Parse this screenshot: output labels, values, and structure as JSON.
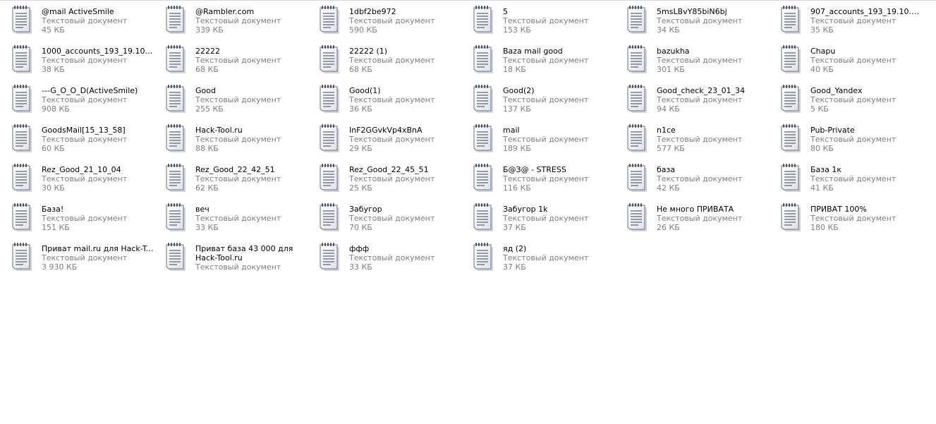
{
  "files": [
    {
      "name": "@mail ActiveSmile",
      "type": "Текстовый документ",
      "size": "45 КБ"
    },
    {
      "name": "@Rambler.com",
      "type": "Текстовый документ",
      "size": "339 КБ"
    },
    {
      "name": "1dbf2be972",
      "type": "Текстовый документ",
      "size": "590 КБ"
    },
    {
      "name": "5",
      "type": "Текстовый документ",
      "size": "153 КБ"
    },
    {
      "name": "5msLBvY85biN6bj",
      "type": "Текстовый документ",
      "size": "34 КБ"
    },
    {
      "name": "907_accounts_193_19.10.201...",
      "type": "Текстовый документ",
      "size": "35 КБ"
    },
    {
      "name": "1000_accounts_193_19.10.20...",
      "type": "Текстовый документ",
      "size": "38 КБ"
    },
    {
      "name": "22222",
      "type": "Текстовый документ",
      "size": "68 КБ"
    },
    {
      "name": "22222 (1)",
      "type": "Текстовый документ",
      "size": "68 КБ"
    },
    {
      "name": "Baza mail good",
      "type": "Текстовый документ",
      "size": "18 КБ"
    },
    {
      "name": "bazukha",
      "type": "Текстовый документ",
      "size": "301 КБ"
    },
    {
      "name": "Chapu",
      "type": "Текстовый документ",
      "size": "40 КБ"
    },
    {
      "name": "---G_O_O_D(ActiveSmile)",
      "type": "Текстовый документ",
      "size": "908 КБ"
    },
    {
      "name": "Good",
      "type": "Текстовый документ",
      "size": "255 КБ"
    },
    {
      "name": "Good(1)",
      "type": "Текстовый документ",
      "size": "36 КБ"
    },
    {
      "name": "Good(2)",
      "type": "Текстовый документ",
      "size": "137 КБ"
    },
    {
      "name": "Good_check_23_01_34",
      "type": "Текстовый документ",
      "size": "94 КБ"
    },
    {
      "name": "Good_Yandex",
      "type": "Текстовый документ",
      "size": "5 КБ"
    },
    {
      "name": "GoodsMail[15_13_58]",
      "type": "Текстовый документ",
      "size": "60 КБ"
    },
    {
      "name": "Hack-Tool.ru",
      "type": "Текстовый документ",
      "size": "88 КБ"
    },
    {
      "name": "InF2GGvkVp4xBnA",
      "type": "Текстовый документ",
      "size": "29 КБ"
    },
    {
      "name": "mail",
      "type": "Текстовый документ",
      "size": "189 КБ"
    },
    {
      "name": "n1ce",
      "type": "Текстовый документ",
      "size": "577 КБ"
    },
    {
      "name": "Pub-Private",
      "type": "Текстовый документ",
      "size": "80 КБ"
    },
    {
      "name": "Rez_Good_21_10_04",
      "type": "Текстовый документ",
      "size": "30 КБ"
    },
    {
      "name": "Rez_Good_22_42_51",
      "type": "Текстовый документ",
      "size": "62 КБ"
    },
    {
      "name": "Rez_Good_22_45_51",
      "type": "Текстовый документ",
      "size": "25 КБ"
    },
    {
      "name": "Б@З@ - STRESS",
      "type": "Текстовый документ",
      "size": "116 КБ"
    },
    {
      "name": "база",
      "type": "Текстовый документ",
      "size": "42 КБ"
    },
    {
      "name": "База 1к",
      "type": "Текстовый документ",
      "size": "41 КБ"
    },
    {
      "name": "База!",
      "type": "Текстовый документ",
      "size": "151 КБ"
    },
    {
      "name": "веч",
      "type": "Текстовый документ",
      "size": "33 КБ"
    },
    {
      "name": "Забугор",
      "type": "Текстовый документ",
      "size": "70 КБ"
    },
    {
      "name": "Забугор 1k",
      "type": "Текстовый документ",
      "size": "37 КБ"
    },
    {
      "name": "Не много ПРИВАТА",
      "type": "Текстовый документ",
      "size": "26 КБ"
    },
    {
      "name": "ПРИВАТ 100%",
      "type": "Текстовый документ",
      "size": "180 КБ"
    },
    {
      "name": "Приват mail.ru для Hack-Tool.ru",
      "type": "Текстовый документ",
      "size": "3 930 КБ"
    },
    {
      "name": "Приват база 43 000 для Hack-Tool.ru",
      "type": "Текстовый документ",
      "size": "",
      "wrap": true
    },
    {
      "name": "ффф",
      "type": "Текстовый документ",
      "size": "33 КБ"
    },
    {
      "name": "яд (2)",
      "type": "Текстовый документ",
      "size": "37 КБ"
    }
  ],
  "icon": "text-document-icon"
}
